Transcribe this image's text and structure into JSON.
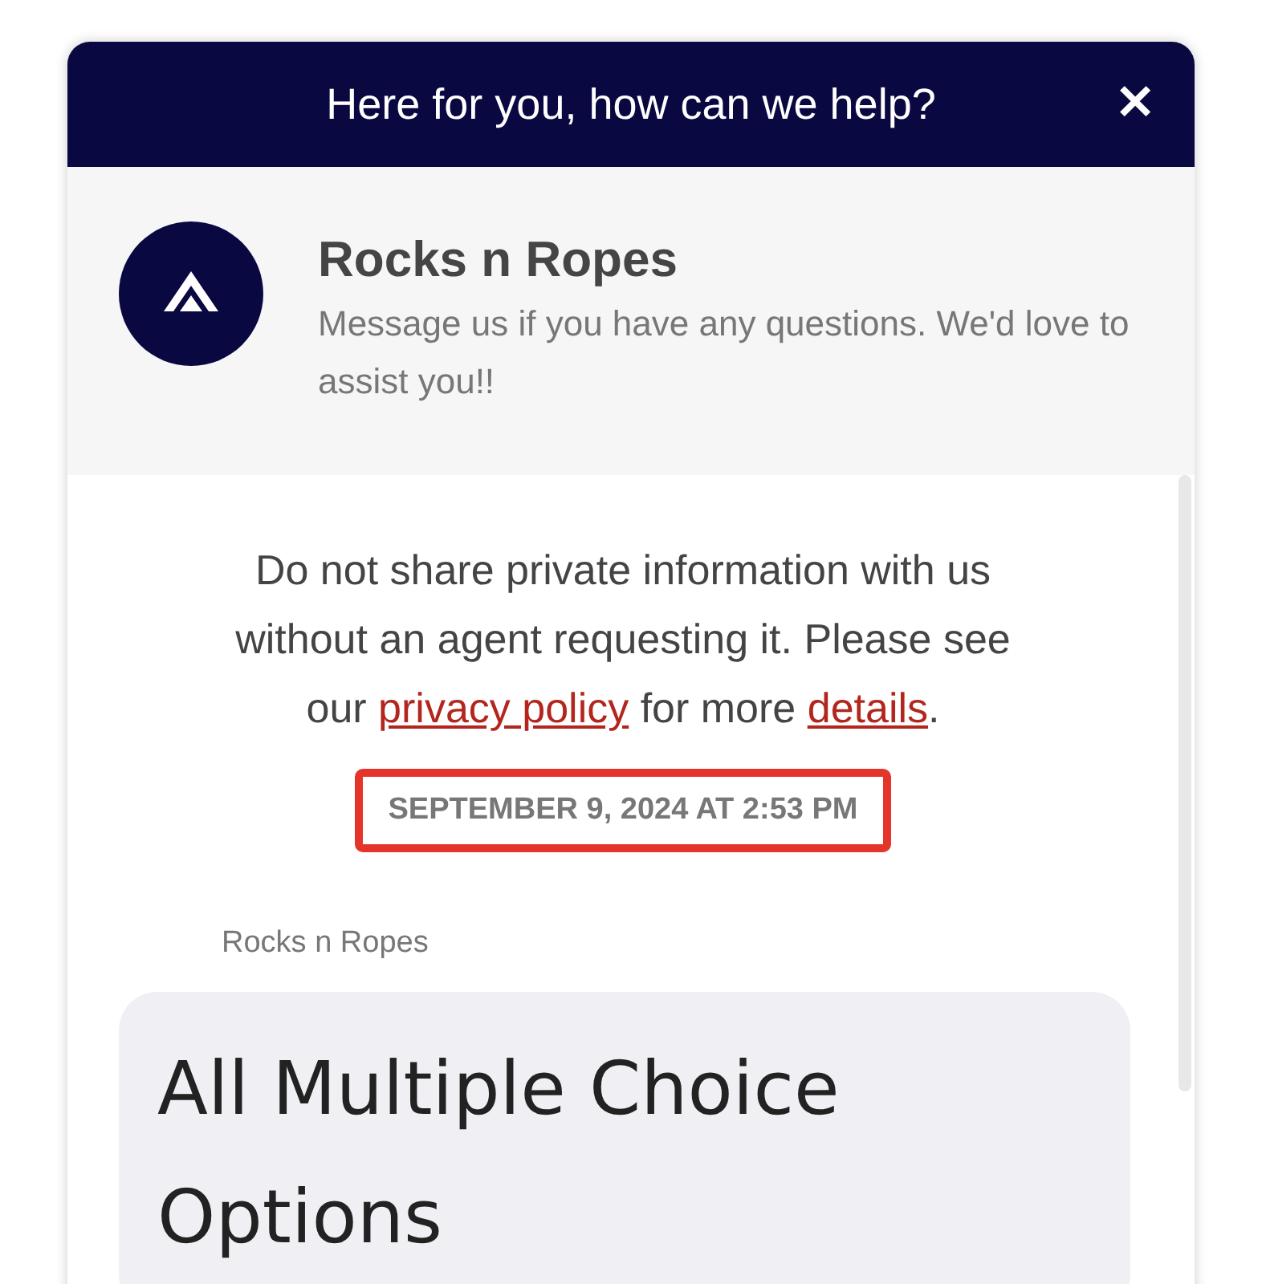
{
  "header": {
    "title": "Here for you, how can we help?",
    "close_label": "✕"
  },
  "profile": {
    "name": "Rocks n Ropes",
    "description": "Message us if you have any questions. We'd love to assist you!!"
  },
  "notice": [
    {
      "kind": "text",
      "text": "Do not share private information with us without an agent requesting it. Please see our "
    },
    {
      "kind": "link",
      "text": "privacy policy"
    },
    {
      "kind": "text",
      "text": " for more "
    },
    {
      "kind": "link",
      "text": "details"
    },
    {
      "kind": "text",
      "text": "."
    }
  ],
  "timestamp": {
    "text": "SEPTEMBER 9, 2024 AT 2:53 PM",
    "highlighted": true
  },
  "messages": [
    {
      "sender": "Rocks n Ropes",
      "text": "All Multiple Choice Options"
    }
  ]
}
